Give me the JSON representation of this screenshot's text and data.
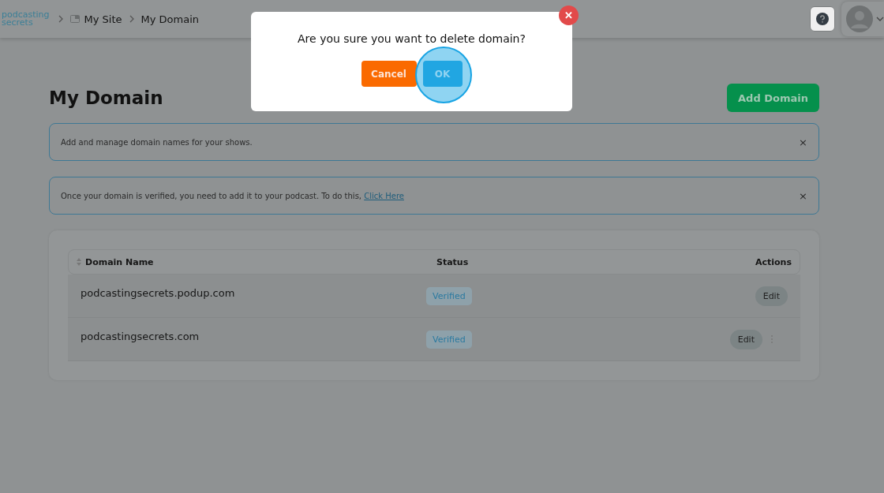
{
  "header": {
    "logo": [
      "podcasting",
      "secrets"
    ],
    "breadcrumb": [
      {
        "label": "My Site",
        "kind": "folder"
      },
      {
        "label": "My Domain",
        "kind": "plain"
      }
    ]
  },
  "page": {
    "title": "My Domain",
    "add_button": "Add Domain"
  },
  "notices": [
    {
      "text": "Add and manage domain names for your shows.",
      "dismiss": "×"
    },
    {
      "text": "Once your domain is verified, you need to add it to your podcast. To do this, ",
      "link": "Click Here",
      "dismiss": "×"
    }
  ],
  "table": {
    "columns": [
      "Domain Name",
      "Status",
      "Actions"
    ],
    "rows": [
      {
        "domain": "podcastingsecrets.podup.com",
        "status": "Verified",
        "action": "Edit",
        "more_menu": false
      },
      {
        "domain": "podcastingsecrets.com",
        "status": "Verified",
        "action": "Edit",
        "more_menu": true
      }
    ]
  },
  "dialog": {
    "message": "Are you sure you want to delete domain?",
    "close": "✕",
    "buttons": [
      {
        "label": "Cancel",
        "kind": "cancel",
        "highlighted": false
      },
      {
        "label": "OK",
        "kind": "ok",
        "highlighted": true
      }
    ]
  }
}
